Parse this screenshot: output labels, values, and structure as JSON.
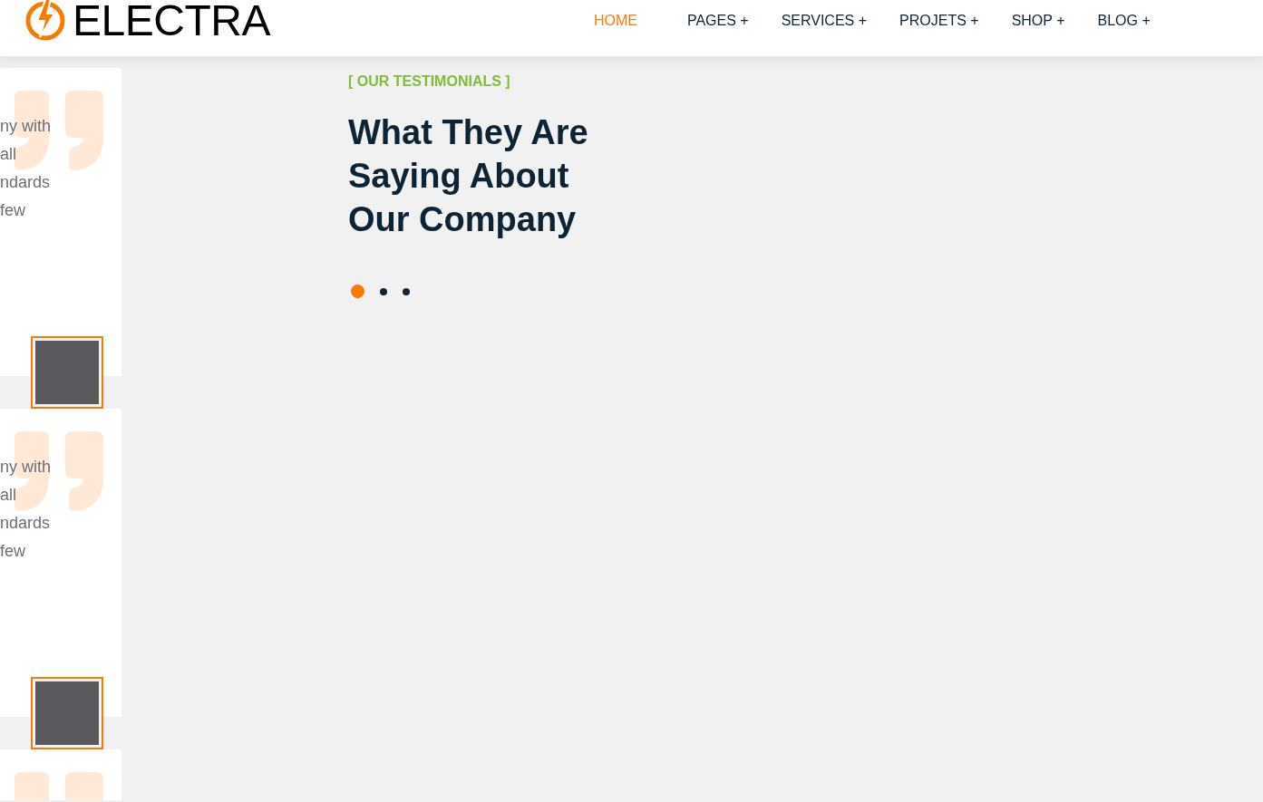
{
  "header": {
    "logo_text": "ELECTRA",
    "nav": [
      {
        "label": "HOME",
        "selected": true
      },
      {
        "label": "PAGES",
        "selected": false,
        "submenu_mark": "+"
      },
      {
        "label": "SERVICES",
        "selected": false,
        "submenu_mark": "+"
      },
      {
        "label": "PROJETS",
        "selected": false,
        "submenu_mark": "+"
      },
      {
        "label": "SHOP",
        "selected": false,
        "submenu_mark": "+"
      },
      {
        "label": "BLOG",
        "selected": false,
        "submenu_mark": "+"
      }
    ]
  },
  "testimonial_cards": [
    {
      "kind": "full",
      "lines": [
        "ny with",
        "all",
        "ndards",
        "few"
      ]
    },
    {
      "kind": "full",
      "lines": [
        "ny with",
        "all",
        "ndards",
        "few"
      ]
    },
    {
      "kind": "partial"
    }
  ],
  "section": {
    "eyebrow": "[ OUR TESTIMONIALS ]",
    "heading_lines": [
      "What They Are",
      "Saying About",
      "Our Company"
    ],
    "dots": [
      {
        "selected": true
      },
      {
        "selected": false
      },
      {
        "selected": false
      }
    ]
  }
}
